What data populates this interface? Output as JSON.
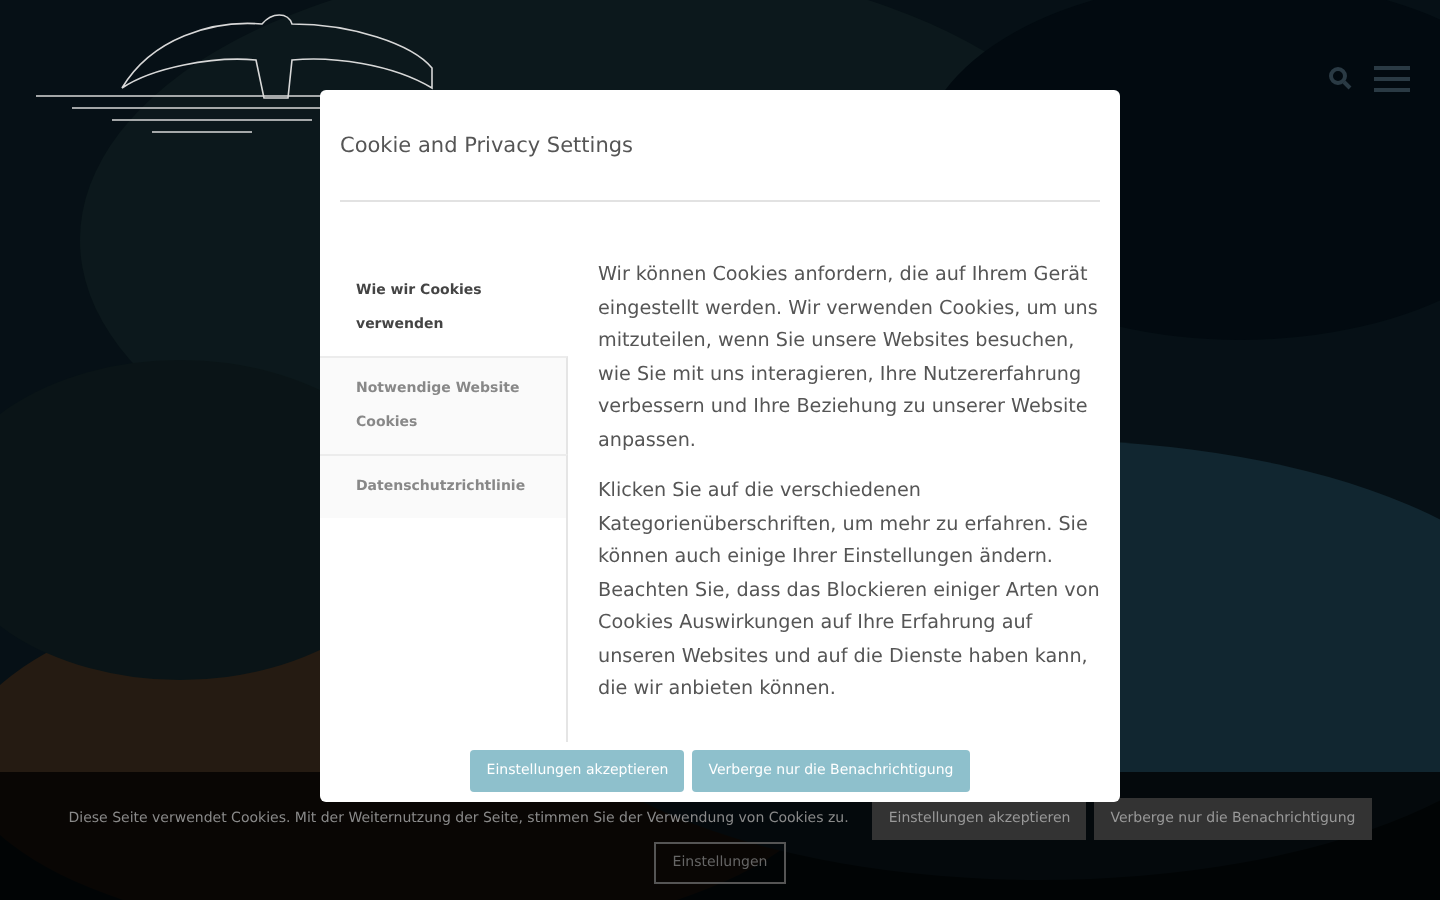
{
  "modal": {
    "title": "Cookie and Privacy Settings",
    "tabs": [
      {
        "label": "Wie wir Cookies verwenden",
        "selected": true
      },
      {
        "label": "Notwendige Website Cookies",
        "selected": false
      },
      {
        "label": "Datenschutzrichtlinie",
        "selected": false
      }
    ],
    "paragraphs": [
      "Wir können Cookies anfordern, die auf Ihrem Gerät eingestellt werden. Wir verwenden Cookies, um uns mitzuteilen, wenn Sie unsere Websites besuchen, wie Sie mit uns interagieren, Ihre Nutzererfahrung verbessern und Ihre Beziehung zu unserer Website anpassen.",
      "Klicken Sie auf die verschiedenen Kategorienüberschriften, um mehr zu erfahren. Sie können auch einige Ihrer Einstellungen ändern. Beachten Sie, dass das Blockieren einiger Arten von Cookies Auswirkungen auf Ihre Erfahrung auf unseren Websites und auf die Dienste haben kann, die wir anbieten können."
    ],
    "buttons": [
      "Einstellungen akzeptieren",
      "Verberge nur die Benachrichtigung"
    ]
  },
  "cookie_bar": {
    "text": "Diese Seite verwendet Cookies. Mit der Weiternutzung der Seite, stimmen Sie der Verwendung von Cookies zu.",
    "buttons": [
      "Einstellungen akzeptieren",
      "Verberge nur die Benachrichtigung"
    ],
    "settings_button": "Einstellungen"
  }
}
